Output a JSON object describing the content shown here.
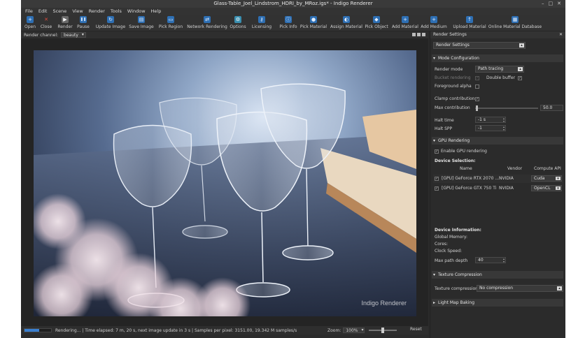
{
  "window": {
    "title": "Glass-Table_Joel_Lindstrom_HDRI_by_MRoz.igs* - Indigo Renderer",
    "controls": [
      "–",
      "□",
      "✕"
    ]
  },
  "menu": [
    "File",
    "Edit",
    "Scene",
    "View",
    "Render",
    "Tools",
    "Window",
    "Help"
  ],
  "toolbar": [
    {
      "label": "Open",
      "icon": "plus-icon",
      "glyph": "+"
    },
    {
      "label": "Close",
      "icon": "close-icon",
      "glyph": "✕"
    },
    {
      "label": "Render",
      "icon": "render-icon",
      "glyph": "▶"
    },
    {
      "label": "Pause",
      "icon": "pause-icon",
      "glyph": "❚❚"
    },
    {
      "label": "Update Image",
      "icon": "refresh-icon",
      "glyph": "↻"
    },
    {
      "label": "Save Image",
      "icon": "save-icon",
      "glyph": "▤"
    },
    {
      "label": "Pick Region",
      "icon": "region-icon",
      "glyph": "▭"
    },
    {
      "label": "Network Rendering",
      "icon": "network-icon",
      "glyph": "⇄"
    },
    {
      "label": "Options",
      "icon": "gear-icon",
      "glyph": "⚙"
    },
    {
      "label": "Licensing",
      "icon": "key-icon",
      "glyph": "⚷"
    },
    {
      "label": "Pick Info",
      "icon": "pick-info-icon",
      "glyph": "ⓘ"
    },
    {
      "label": "Pick Material",
      "icon": "pick-material-icon",
      "glyph": "●"
    },
    {
      "label": "Assign Material",
      "icon": "assign-material-icon",
      "glyph": "◐"
    },
    {
      "label": "Pick Object",
      "icon": "pick-object-icon",
      "glyph": "◆"
    },
    {
      "label": "Add Material",
      "icon": "add-material-icon",
      "glyph": "+"
    },
    {
      "label": "Add Medium",
      "icon": "add-medium-icon",
      "glyph": "+"
    },
    {
      "label": "Upload Material",
      "icon": "upload-icon",
      "glyph": "↑"
    },
    {
      "label": "Online Material Database",
      "icon": "database-icon",
      "glyph": "▦"
    }
  ],
  "channel": {
    "label": "Render channel:",
    "value": "beauty"
  },
  "status": {
    "progress": 0.55,
    "message": "Rendering... | Time elapsed: 7 m, 20 s, next image update in 3 s | Samples per pixel: 3151.00, 19.342 M samples/s",
    "zoom_label": "Zoom:",
    "zoom_value": "100%",
    "zoom_slider": 0.5,
    "reset": "Reset"
  },
  "photo": {
    "watermark": "Indigo Renderer"
  },
  "panel": {
    "title": "Render Settings",
    "dropdown": "Render Settings",
    "mode": {
      "section": "Mode Configuration",
      "render_mode_label": "Render mode",
      "render_mode_value": "Path tracing",
      "bucket_label": "Bucket rendering",
      "bidir_label": "Double buffer",
      "foreground_label": "Foreground alpha",
      "clamp_label": "Clamp contributions",
      "max_contrib_label": "Max contribution",
      "max_contrib_value": "50.0",
      "max_contrib_fraction": 0.02,
      "halt_time_label": "Halt time",
      "halt_time_value": "-1 s",
      "halt_spp_label": "Halt SPP",
      "halt_spp_value": "-1"
    },
    "gpu": {
      "section": "GPU Rendering",
      "enable_label": "Enable GPU rendering",
      "device_selection": "Device Selection:",
      "columns": [
        "Name",
        "Vendor",
        "Compute API"
      ],
      "devices": [
        {
          "name": "[GPU] GeForce RTX 2070 ...",
          "vendor": "NVIDIA",
          "api": "Cuda"
        },
        {
          "name": "[GPU] GeForce GTX 750 Ti",
          "vendor": "NVIDIA",
          "api": "OpenCL"
        }
      ],
      "device_info": "Device Information:",
      "global_memory": "Global Memory:",
      "cores": "Cores:",
      "clock_speed": "Clock Speed:",
      "max_path_depth_label": "Max path depth",
      "max_path_depth_value": "40"
    },
    "texture": {
      "section": "Texture Compression",
      "label": "Texture compression",
      "value": "No compression"
    },
    "lightmap": {
      "section": "Light Map Baking"
    }
  }
}
